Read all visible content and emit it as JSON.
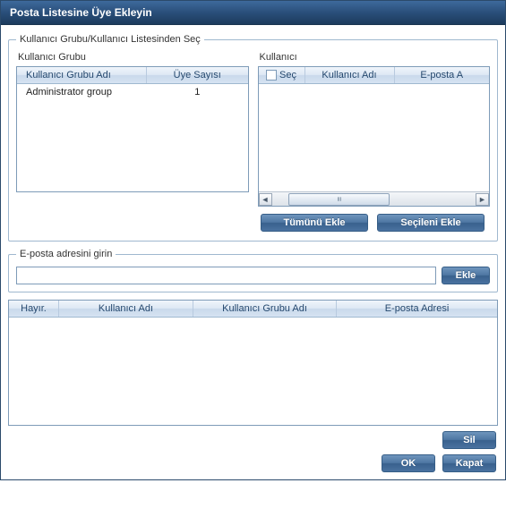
{
  "dialog": {
    "title": "Posta Listesine Üye Ekleyin"
  },
  "selectFromList": {
    "legend": "Kullanıcı Grubu/Kullanıcı Listesinden Seç",
    "group": {
      "label": "Kullanıcı Grubu",
      "columns": {
        "name": "Kullanıcı Grubu Adı",
        "count": "Üye Sayısı"
      },
      "rows": [
        {
          "name": "Administrator group",
          "count": "1"
        }
      ]
    },
    "user": {
      "label": "Kullanıcı",
      "columns": {
        "select": "Seç",
        "name": "Kullanıcı Adı",
        "email": "E-posta A"
      },
      "rows": []
    },
    "buttons": {
      "addAll": "Tümünü Ekle",
      "addSelected": "Seçileni Ekle"
    }
  },
  "emailEntry": {
    "legend": "E-posta adresini girin",
    "value": "",
    "placeholder": "",
    "btn": "Ekle"
  },
  "resultGrid": {
    "columns": {
      "no": "Hayır.",
      "user": "Kullanıcı Adı",
      "group": "Kullanıcı Grubu Adı",
      "email": "E-posta Adresi"
    },
    "rows": []
  },
  "footer": {
    "delete": "Sil",
    "ok": "OK",
    "close": "Kapat"
  }
}
